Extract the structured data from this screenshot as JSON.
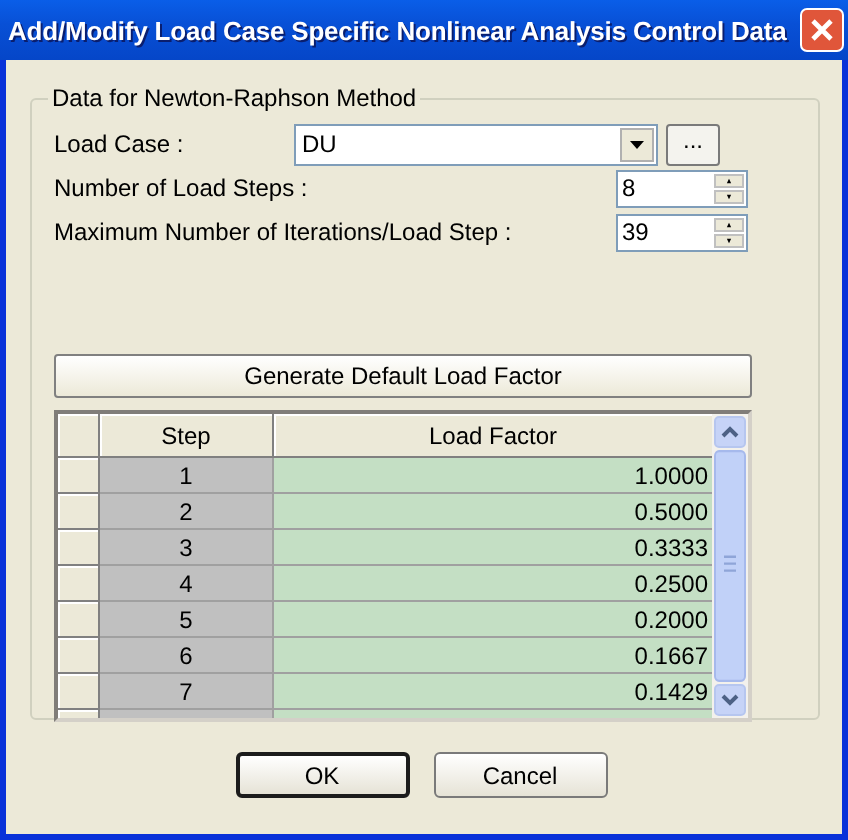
{
  "window": {
    "title": "Add/Modify Load Case Specific Nonlinear Analysis Control Data"
  },
  "group": {
    "title": "Data for Newton-Raphson Method"
  },
  "load_case": {
    "label": "Load Case :",
    "value": "DU",
    "browse_button": "..."
  },
  "fields": [
    {
      "label": "Number of Load Steps :",
      "value": "8"
    },
    {
      "label": "Maximum Number of Iterations/Load Step :",
      "value": "39"
    }
  ],
  "generate_button": "Generate Default Load Factor",
  "table": {
    "columns": [
      "Step",
      "Load Factor"
    ],
    "rows": [
      [
        "1",
        "1.0000"
      ],
      [
        "2",
        "0.5000"
      ],
      [
        "3",
        "0.3333"
      ],
      [
        "4",
        "0.2500"
      ],
      [
        "5",
        "0.2000"
      ],
      [
        "6",
        "0.1667"
      ],
      [
        "7",
        "0.1429"
      ]
    ]
  },
  "buttons": [
    {
      "label": "OK",
      "default": true
    },
    {
      "label": "Cancel",
      "default": false
    }
  ]
}
